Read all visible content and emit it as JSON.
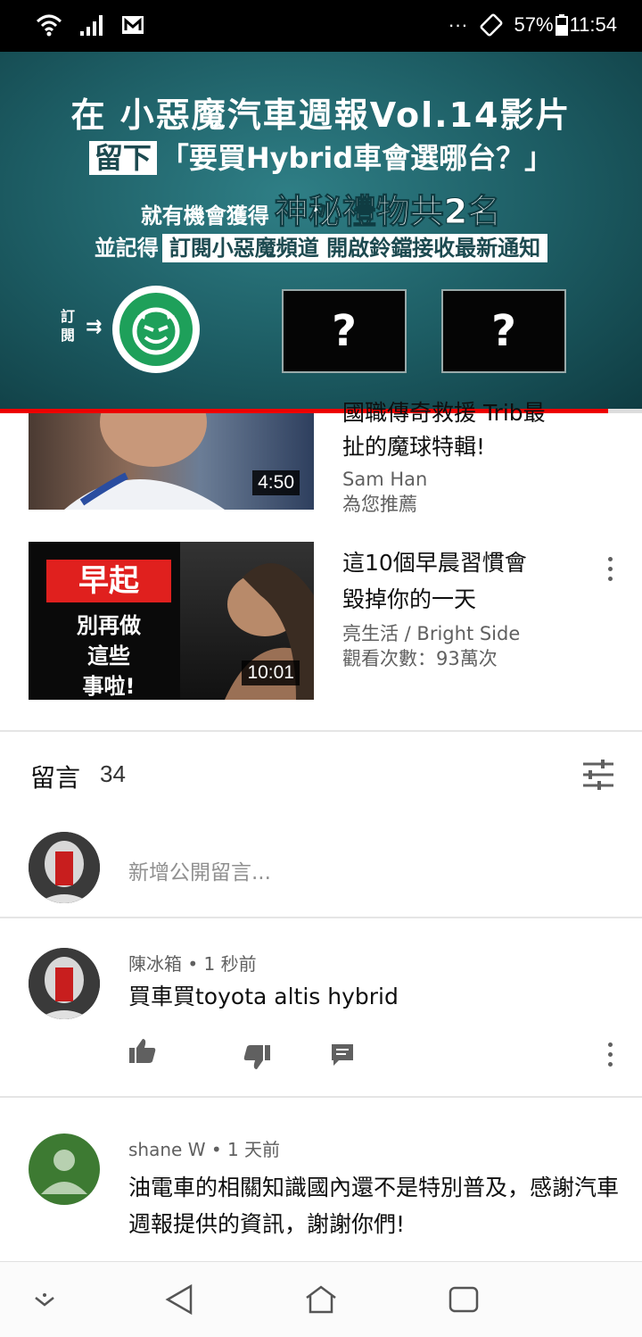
{
  "status_bar": {
    "icons": [
      "wifi-icon",
      "signal-icon",
      "mail-icon",
      "more-icon",
      "rotate-icon",
      "battery-icon"
    ],
    "more": "···",
    "battery": "57%",
    "time": "11:54"
  },
  "player": {
    "line1": "在 小惡魔汽車週報Vol.14影片",
    "line2_box": "留下",
    "line2": "「要買Hybrid車會選哪台？」",
    "line3": "就有機會獲得",
    "line3_big": "神秘禮物共2名",
    "line4": "並記得",
    "line4_box": "訂閱小惡魔頻道 開啟鈴鐺接收最新通知",
    "subscribe_label": "訂閱",
    "mystery1": "?",
    "mystery2": "?",
    "progress": 0.947
  },
  "related": [
    {
      "title_line1": "國職傳奇救援 Trib最",
      "title_line2": "扯的魔球特輯!",
      "channel": "Sam Han",
      "meta": "為您推薦",
      "duration": "4:50"
    },
    {
      "title_line1": "這10個早晨習慣會",
      "title_line2": "毀掉你的一天",
      "channel": "亮生活 / Bright Side",
      "meta": "觀看次數：93萬次",
      "duration": "10:01",
      "thumb_badge": "早起",
      "thumb_text1": "別再做",
      "thumb_text2": "這些",
      "thumb_text3": "事啦!"
    }
  ],
  "comments_section": {
    "title": "留言",
    "count": "34",
    "add_placeholder": "新增公開留言..."
  },
  "comments": [
    {
      "author": "陳冰箱 • 1 秒前",
      "text": "買車買toyota altis hybrid"
    },
    {
      "author": "shane W • 1 天前",
      "text": "油電車的相關知識國內還不是特別普及，感謝汽車週報提供的資訊，謝謝你們!"
    }
  ],
  "colors": {
    "progress_red": "#ee0000",
    "banner_teal": "#1c5b62",
    "logo_green": "#1ea05a",
    "badge_red": "#e0201e",
    "avatar_green": "#3d7a32"
  }
}
